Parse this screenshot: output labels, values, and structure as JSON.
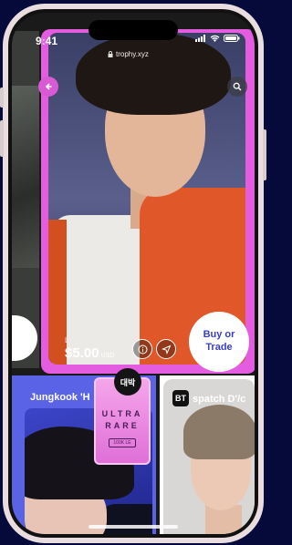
{
  "status_bar": {
    "time": "9:41",
    "url": "trophy.xyz"
  },
  "main_card": {
    "lowest_ask_label": "Lowest ask",
    "price": "$5.00",
    "currency": "USD",
    "buy_label": "Buy or Trade",
    "accent_color": "#e45de0"
  },
  "cards": [
    {
      "title": "Jungkook 'H",
      "background": "#5a62e6"
    },
    {
      "logo": "BT",
      "title": "spatch   D'/c",
      "background": "#ffffff"
    }
  ],
  "badge": {
    "stamp": "대박",
    "line1": "ULTRA",
    "line2": "RARE",
    "line3": "100K LE"
  },
  "icons": [
    "back-arrow-icon",
    "search-icon",
    "info-icon",
    "share-icon",
    "lock-icon",
    "signal-icon",
    "wifi-icon",
    "battery-icon"
  ]
}
